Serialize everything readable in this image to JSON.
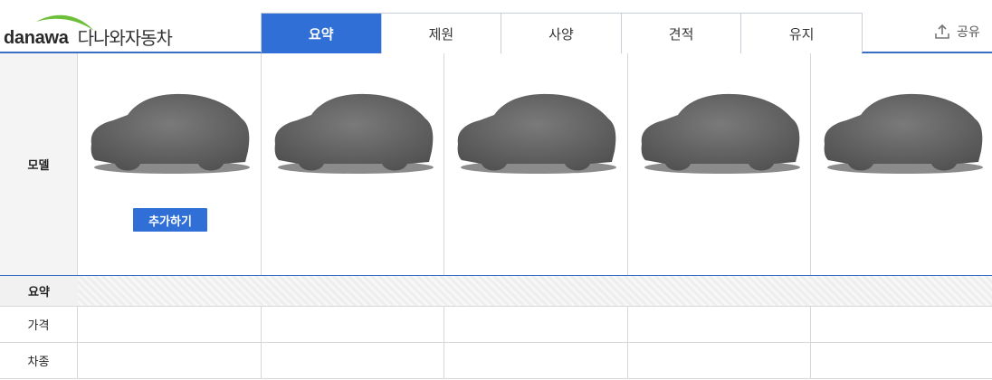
{
  "header": {
    "logo_en": "danawa",
    "logo_ko": "다나와자동차",
    "tabs": [
      {
        "label": "요약",
        "active": true
      },
      {
        "label": "제원",
        "active": false
      },
      {
        "label": "사양",
        "active": false
      },
      {
        "label": "견적",
        "active": false
      },
      {
        "label": "유지",
        "active": false
      }
    ],
    "share_label": "공유",
    "share_icon": "upload-share-icon"
  },
  "colors": {
    "accent": "#2f6fd6",
    "border_blue": "#3a6fc4",
    "car_silhouette": "#5e5e5e",
    "logo_swoosh": "#6cbf3a"
  },
  "table": {
    "model_label": "모델",
    "add_button_label": "추가하기",
    "slots": 5,
    "section_summary": "요약",
    "rows": [
      {
        "label": "가격"
      },
      {
        "label": "차종"
      }
    ]
  }
}
